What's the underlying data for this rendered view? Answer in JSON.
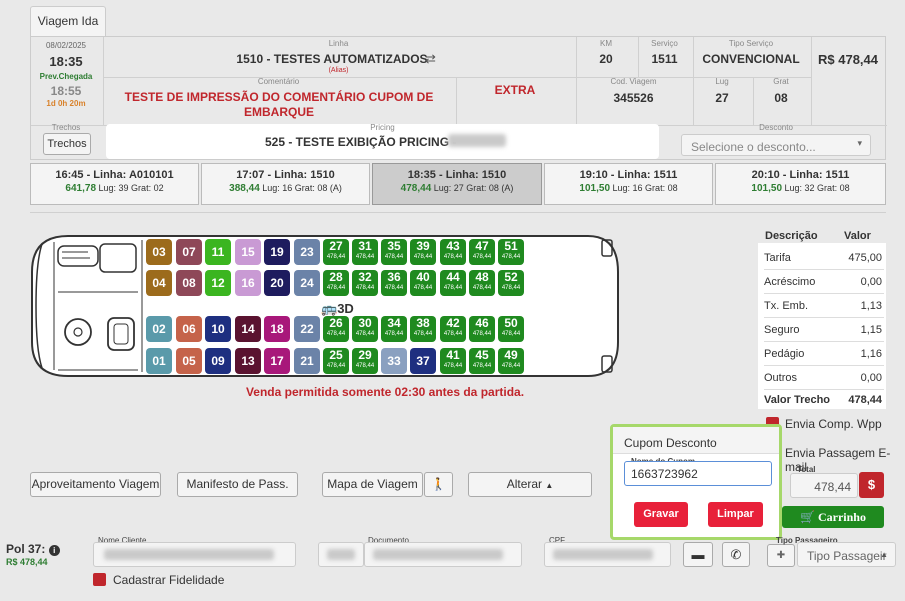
{
  "tab": {
    "label": "Viagem Ida"
  },
  "trip": {
    "date": "08/02/2025",
    "time": "18:35",
    "prev_label": "Prev.Chegada",
    "arrival": "18:55",
    "duration": "1d 0h 20m",
    "linha_label": "Linha",
    "linha": "1510 - TESTES AUTOMATIZADOS",
    "alias": "(Alias)",
    "km_label": "KM",
    "km": "20",
    "servico_label": "Serviço",
    "servico": "1511",
    "tipo_servico_label": "Tipo Serviço",
    "tipo_servico": "CONVENCIONAL",
    "price": "R$ 478,44",
    "comentario_label": "Comentário",
    "comentario": "TESTE DE IMPRESSÃO DO COMENTÁRIO CUPOM DE EMBARQUE",
    "extra": "EXTRA",
    "cod_viagem_label": "Cod. Viagem",
    "cod_viagem": "345526",
    "lug_label": "Lug",
    "lug": "27",
    "grat_label": "Grat",
    "grat": "08",
    "trechos_label": "Trechos",
    "trechos_btn": "Trechos",
    "pricing_label": "Pricing",
    "pricing": "525 - TESTE EXIBIÇÃO PRICING -",
    "desconto_label": "Desconto",
    "desconto_placeholder": "Selecione o desconto..."
  },
  "schedules": [
    {
      "title": "16:45 - Linha: A010101",
      "price": "641,78",
      "info": "Lug: 39 Grat: 02"
    },
    {
      "title": "17:07 - Linha: 1510",
      "price": "388,44",
      "info": "Lug: 16 Grat: 08 (A)"
    },
    {
      "title": "18:35 - Linha: 1510",
      "price": "478,44",
      "info": "Lug: 27 Grat: 08 (A)"
    },
    {
      "title": "19:10 - Linha: 1511",
      "price": "101,50",
      "info": "Lug: 16 Grat: 08"
    },
    {
      "title": "20:10 - Linha: 1511",
      "price": "101,50",
      "info": "Lug: 32 Grat: 08"
    }
  ],
  "seats": {
    "occupied": [
      {
        "n": "03",
        "c": "#9c6b1c"
      },
      {
        "n": "07",
        "c": "#8e4858"
      },
      {
        "n": "11",
        "c": "#3bb520"
      },
      {
        "n": "15",
        "c": "#c99ad4"
      },
      {
        "n": "19",
        "c": "#1e1c5e"
      },
      {
        "n": "23",
        "c": "#6b83a8"
      },
      {
        "n": "04",
        "c": "#9c6b1c"
      },
      {
        "n": "08",
        "c": "#8e4858"
      },
      {
        "n": "12",
        "c": "#3bb520"
      },
      {
        "n": "16",
        "c": "#c99ad4"
      },
      {
        "n": "20",
        "c": "#1e1c5e"
      },
      {
        "n": "24",
        "c": "#6b83a8"
      },
      {
        "n": "02",
        "c": "#5a9aaa"
      },
      {
        "n": "06",
        "c": "#c5634a"
      },
      {
        "n": "10",
        "c": "#1e2f80"
      },
      {
        "n": "14",
        "c": "#5a1330"
      },
      {
        "n": "18",
        "c": "#a8187a"
      },
      {
        "n": "22",
        "c": "#6b83a8"
      },
      {
        "n": "01",
        "c": "#5a9aaa"
      },
      {
        "n": "05",
        "c": "#c5634a"
      },
      {
        "n": "09",
        "c": "#1e2f80"
      },
      {
        "n": "13",
        "c": "#5a1330"
      },
      {
        "n": "17",
        "c": "#a8187a"
      },
      {
        "n": "21",
        "c": "#6b83a8"
      },
      {
        "n": "33",
        "c": "#8aa0c0"
      },
      {
        "n": "37",
        "c": "#1e2f80"
      }
    ],
    "available": [
      {
        "n": "27",
        "p": "478,44"
      },
      {
        "n": "31",
        "p": "478,44"
      },
      {
        "n": "35",
        "p": "478,44"
      },
      {
        "n": "39",
        "p": "478,44"
      },
      {
        "n": "43",
        "p": "478,44"
      },
      {
        "n": "47",
        "p": "478,44"
      },
      {
        "n": "51",
        "p": "478,44"
      },
      {
        "n": "28",
        "p": "478,44"
      },
      {
        "n": "32",
        "p": "478,44"
      },
      {
        "n": "36",
        "p": "478,44"
      },
      {
        "n": "40",
        "p": "478,44"
      },
      {
        "n": "44",
        "p": "478,44"
      },
      {
        "n": "48",
        "p": "478,44"
      },
      {
        "n": "52",
        "p": "478,44"
      },
      {
        "n": "26",
        "p": "478,44"
      },
      {
        "n": "30",
        "p": "478,44"
      },
      {
        "n": "34",
        "p": "478,44"
      },
      {
        "n": "38",
        "p": "478,44"
      },
      {
        "n": "42",
        "p": "478,44"
      },
      {
        "n": "46",
        "p": "478,44"
      },
      {
        "n": "50",
        "p": "478,44"
      },
      {
        "n": "25",
        "p": "478,44"
      },
      {
        "n": "29",
        "p": "478,44"
      },
      {
        "n": "41",
        "p": "478,44"
      },
      {
        "n": "45",
        "p": "478,44"
      },
      {
        "n": "49",
        "p": "478,44"
      }
    ],
    "view3d": "3D",
    "warning": "Venda permitida somente 02:30 antes da partida."
  },
  "descricao": {
    "head_desc": "Descrição",
    "head_valor": "Valor",
    "rows": [
      {
        "label": "Tarifa",
        "value": "475,00"
      },
      {
        "label": "Acréscimo",
        "value": "0,00"
      },
      {
        "label": "Tx. Emb.",
        "value": "1,13"
      },
      {
        "label": "Seguro",
        "value": "1,15"
      },
      {
        "label": "Pedágio",
        "value": "1,16"
      },
      {
        "label": "Outros",
        "value": "0,00"
      },
      {
        "label": "Valor Trecho",
        "value": "478,44"
      }
    ]
  },
  "options": {
    "envia_wpp": "Envia Comp. Wpp",
    "envia_email": "Envia Passagem E-mail",
    "total_label": "Total",
    "total": "478,44",
    "carrinho": "Carrinho"
  },
  "actions": {
    "aproveitamento": "Aproveitamento Viagem",
    "manifesto": "Manifesto de Pass.",
    "mapa": "Mapa de Viagem",
    "alterar": "Alterar"
  },
  "cupom": {
    "title": "Cupom Desconto",
    "field_label": "Nome do Cupom",
    "value": "1663723962",
    "gravar": "Gravar",
    "limpar": "Limpar"
  },
  "passenger": {
    "pol": "Pol 37:",
    "pol_price": "R$ 478,44",
    "nome_label": "Nome Cliente",
    "documento_label": "Documento",
    "cpf_label": "CPF",
    "tipo_label": "Tipo Passageiro",
    "tipo_placeholder": "Tipo Passageir",
    "fidelidade": "Cadastrar Fidelidade"
  }
}
